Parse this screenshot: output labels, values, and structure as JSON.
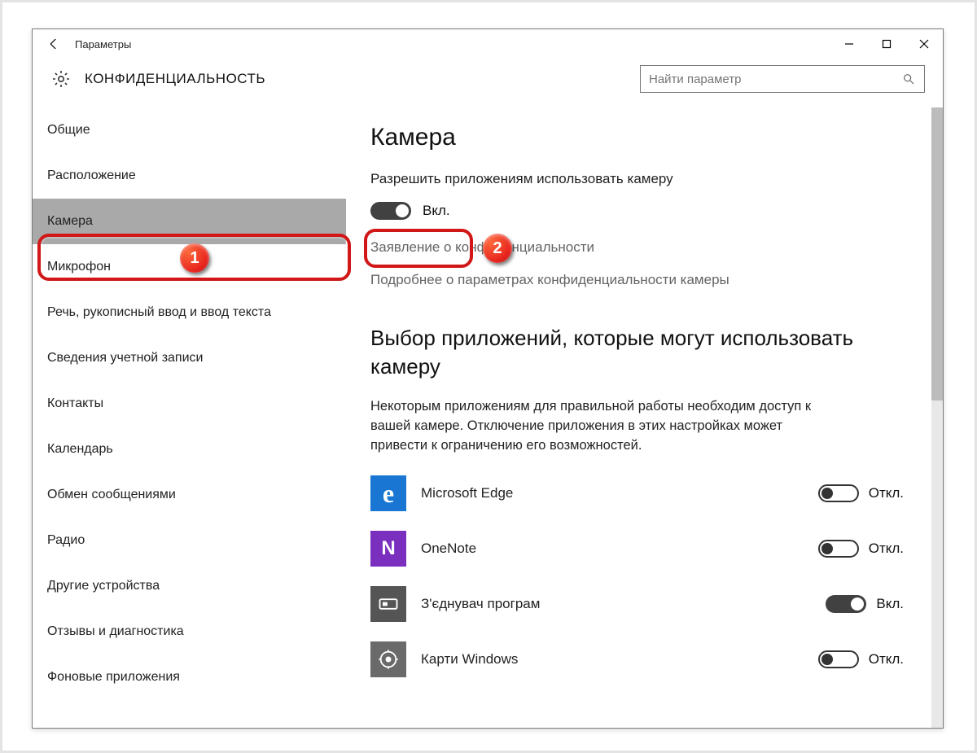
{
  "window": {
    "app_title": "Параметры",
    "page_title": "КОНФИДЕНЦИАЛЬНОСТЬ",
    "search_placeholder": "Найти параметр"
  },
  "sidebar": {
    "items": [
      {
        "label": "Общие"
      },
      {
        "label": "Расположение"
      },
      {
        "label": "Камера"
      },
      {
        "label": "Микрофон"
      },
      {
        "label": "Речь, рукописный ввод и ввод текста"
      },
      {
        "label": "Сведения учетной записи"
      },
      {
        "label": "Контакты"
      },
      {
        "label": "Календарь"
      },
      {
        "label": "Обмен сообщениями"
      },
      {
        "label": "Радио"
      },
      {
        "label": "Другие устройства"
      },
      {
        "label": "Отзывы и диагностика"
      },
      {
        "label": "Фоновые приложения"
      }
    ],
    "selected_index": 2
  },
  "content": {
    "heading": "Камера",
    "allow_label": "Разрешить приложениям использовать камеру",
    "main_toggle": {
      "state": "on",
      "label": "Вкл."
    },
    "link_privacy": "Заявление о конфиденциальности",
    "link_more": "Подробнее о параметрах конфиденциальности камеры",
    "choose_heading": "Выбор приложений, которые могут использовать камеру",
    "choose_desc": "Некоторым приложениям для правильной работы необходим доступ к вашей камере. Отключение приложения в этих настройках может привести к ограничению его возможностей.",
    "on_label": "Вкл.",
    "off_label": "Откл.",
    "apps": [
      {
        "name": "Microsoft Edge",
        "state": "off",
        "icon": "edge"
      },
      {
        "name": "OneNote",
        "state": "off",
        "icon": "onenote"
      },
      {
        "name": "З'єднувач програм",
        "state": "on",
        "icon": "connector"
      },
      {
        "name": "Карти Windows",
        "state": "off",
        "icon": "maps"
      }
    ]
  },
  "annotations": {
    "badge1": "1",
    "badge2": "2"
  },
  "colors": {
    "accent_annot": "#d11717",
    "selected_bg": "#a9a9a9",
    "toggle_on": "#414141"
  }
}
